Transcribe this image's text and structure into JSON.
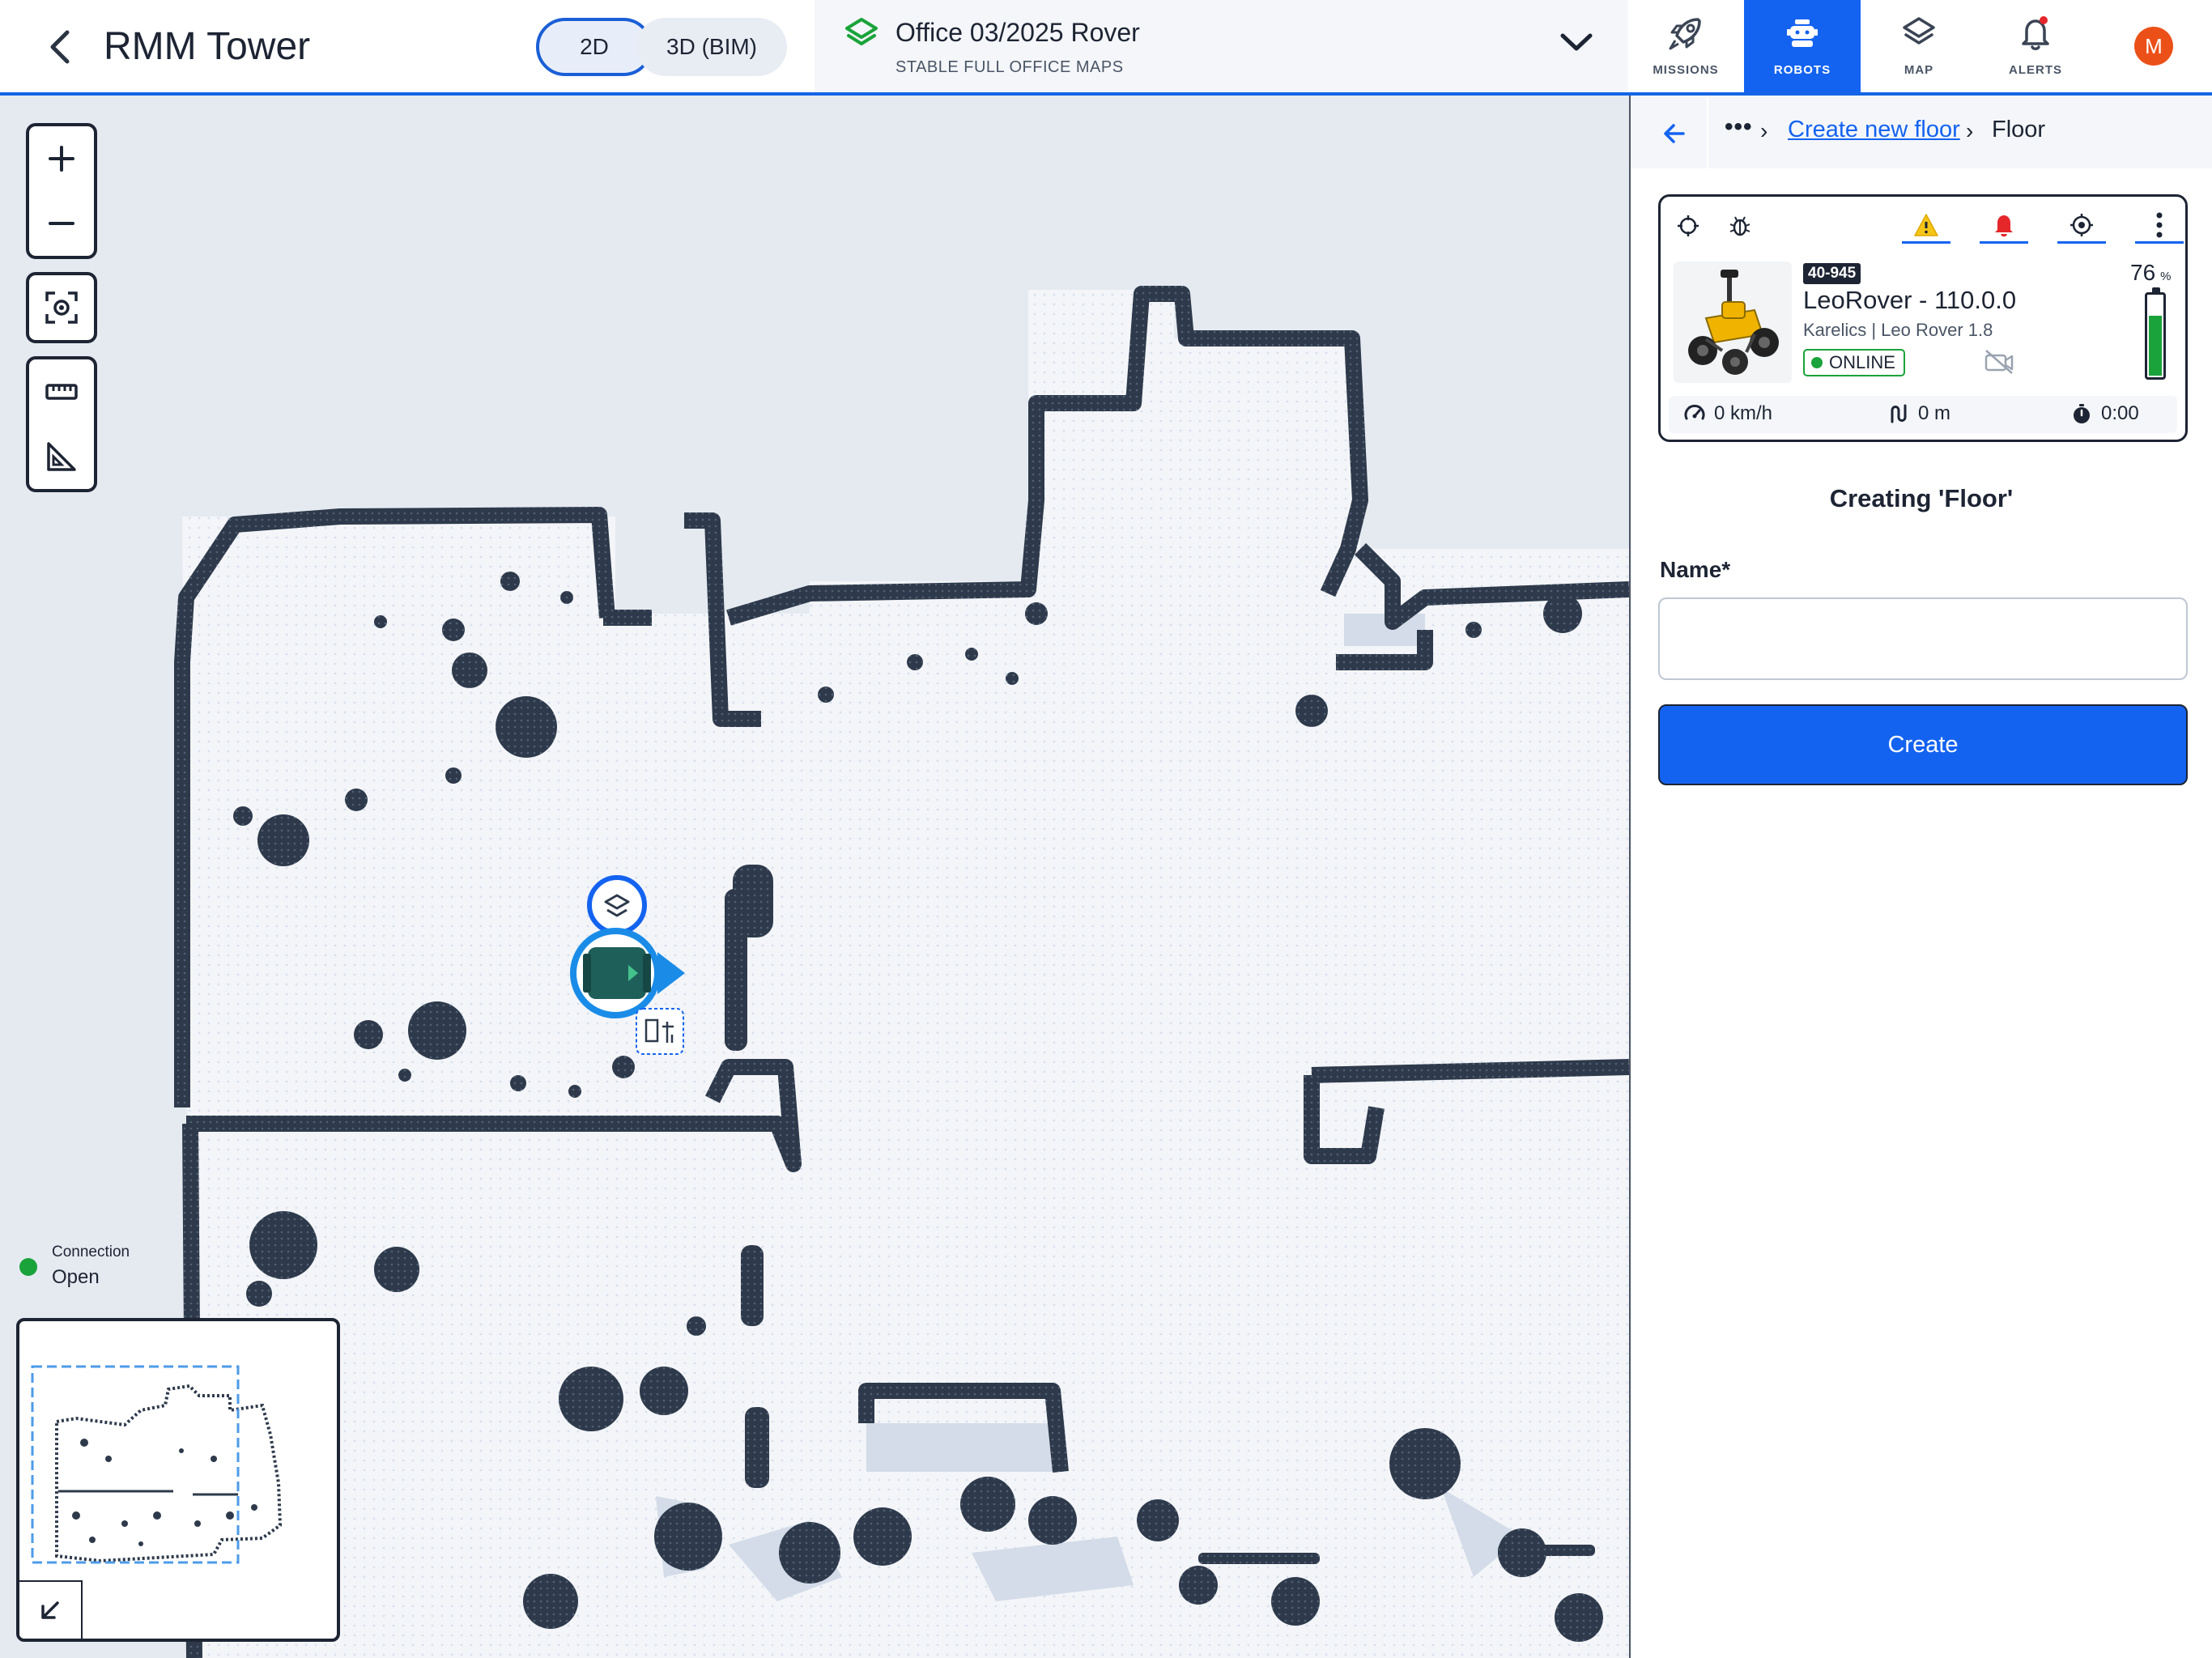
{
  "header": {
    "title": "RMM Tower",
    "view_2d": "2D",
    "view_3d": "3D (BIM)",
    "map_title": "Office 03/2025 Rover",
    "map_subtitle": "STABLE FULL OFFICE MAPS",
    "nav": [
      {
        "label": "MISSIONS",
        "icon": "rocket-icon",
        "active": false
      },
      {
        "label": "ROBOTS",
        "icon": "robot-icon",
        "active": true
      },
      {
        "label": "MAP",
        "icon": "layers-icon",
        "active": false
      },
      {
        "label": "ALERTS",
        "icon": "bell-icon",
        "active": false
      }
    ],
    "avatar_initial": "M"
  },
  "map": {
    "connection_label": "Connection",
    "connection_value": "Open"
  },
  "panel": {
    "breadcrumb": {
      "more": "•••",
      "link": "Create new floor",
      "current": "Floor"
    },
    "robot": {
      "id": "40-945",
      "name": "LeoRover - 110.0.0",
      "subtitle": "Karelics | Leo Rover 1.8",
      "status": "ONLINE",
      "battery_value": "76",
      "battery_unit": "%",
      "battery_fraction": 0.76,
      "speed": "0 km/h",
      "distance": "0 m",
      "time": "0:00"
    },
    "form": {
      "title": "Creating 'Floor'",
      "name_label": "Name*",
      "name_value": "",
      "create_label": "Create"
    }
  },
  "colors": {
    "accent": "#1463f0",
    "online": "#1aa33a",
    "warning": "#f5c518",
    "alert": "#e5262a",
    "avatar": "#ec5019",
    "wall": "#2e3a4b"
  }
}
